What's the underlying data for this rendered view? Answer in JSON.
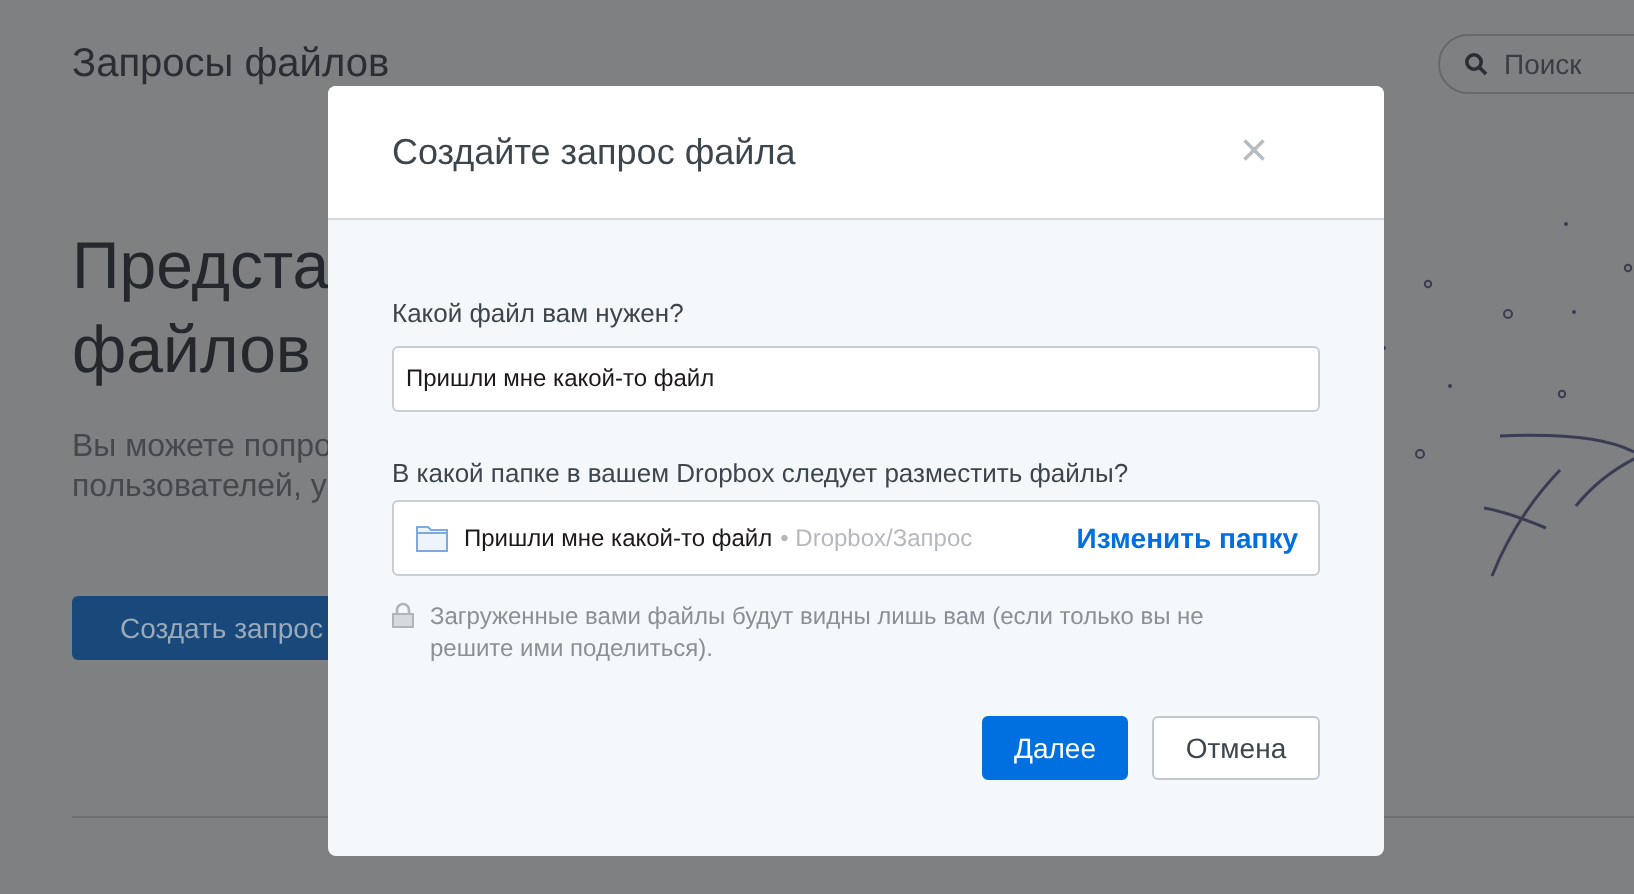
{
  "page": {
    "title": "Запросы файлов",
    "search": {
      "placeholder": "Поиск"
    },
    "headline": [
      "Предста",
      "файлов"
    ],
    "description": [
      "Вы можете попро",
      "пользователей, у"
    ],
    "create_button": "Создать запрос"
  },
  "dialog": {
    "title": "Создайте запрос файла",
    "close": "×",
    "file_field": {
      "label": "Какой файл вам нужен?",
      "value": "Пришли мне какой-то файл"
    },
    "folder_field": {
      "label": "В какой папке в вашем Dropbox следует разместить файлы?",
      "folder_name": "Пришли мне какой-то файл",
      "path": "• Dropbox/Запрос",
      "change_link": "Изменить папку"
    },
    "privacy_note": "Загруженные вами файлы будут видны лишь вам (если только вы не решите ими поделиться).",
    "buttons": [
      {
        "label": "Далее",
        "kind": "primary"
      },
      {
        "label": "Отмена",
        "kind": "secondary"
      }
    ]
  }
}
